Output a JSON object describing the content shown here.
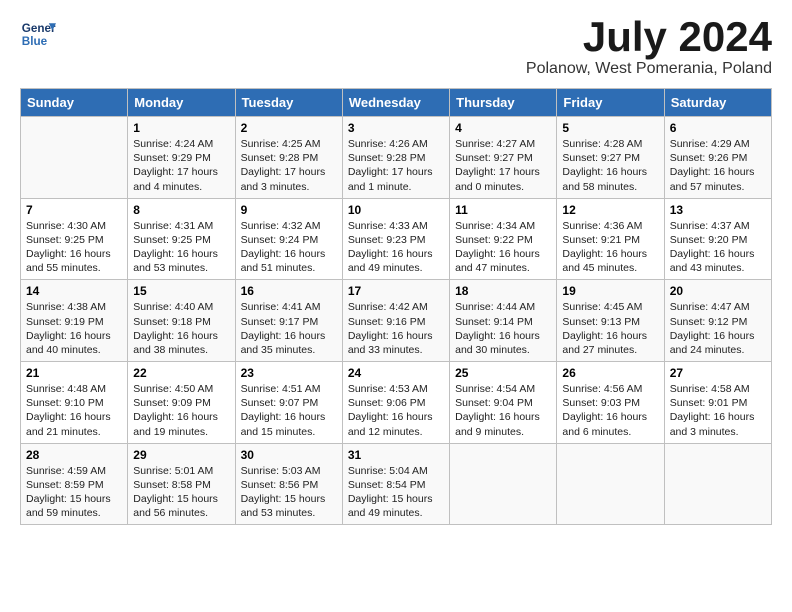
{
  "header": {
    "logo_line1": "General",
    "logo_line2": "Blue",
    "month_title": "July 2024",
    "location": "Polanow, West Pomerania, Poland"
  },
  "days_of_week": [
    "Sunday",
    "Monday",
    "Tuesday",
    "Wednesday",
    "Thursday",
    "Friday",
    "Saturday"
  ],
  "weeks": [
    [
      {
        "day": "",
        "content": ""
      },
      {
        "day": "1",
        "content": "Sunrise: 4:24 AM\nSunset: 9:29 PM\nDaylight: 17 hours\nand 4 minutes."
      },
      {
        "day": "2",
        "content": "Sunrise: 4:25 AM\nSunset: 9:28 PM\nDaylight: 17 hours\nand 3 minutes."
      },
      {
        "day": "3",
        "content": "Sunrise: 4:26 AM\nSunset: 9:28 PM\nDaylight: 17 hours\nand 1 minute."
      },
      {
        "day": "4",
        "content": "Sunrise: 4:27 AM\nSunset: 9:27 PM\nDaylight: 17 hours\nand 0 minutes."
      },
      {
        "day": "5",
        "content": "Sunrise: 4:28 AM\nSunset: 9:27 PM\nDaylight: 16 hours\nand 58 minutes."
      },
      {
        "day": "6",
        "content": "Sunrise: 4:29 AM\nSunset: 9:26 PM\nDaylight: 16 hours\nand 57 minutes."
      }
    ],
    [
      {
        "day": "7",
        "content": "Sunrise: 4:30 AM\nSunset: 9:25 PM\nDaylight: 16 hours\nand 55 minutes."
      },
      {
        "day": "8",
        "content": "Sunrise: 4:31 AM\nSunset: 9:25 PM\nDaylight: 16 hours\nand 53 minutes."
      },
      {
        "day": "9",
        "content": "Sunrise: 4:32 AM\nSunset: 9:24 PM\nDaylight: 16 hours\nand 51 minutes."
      },
      {
        "day": "10",
        "content": "Sunrise: 4:33 AM\nSunset: 9:23 PM\nDaylight: 16 hours\nand 49 minutes."
      },
      {
        "day": "11",
        "content": "Sunrise: 4:34 AM\nSunset: 9:22 PM\nDaylight: 16 hours\nand 47 minutes."
      },
      {
        "day": "12",
        "content": "Sunrise: 4:36 AM\nSunset: 9:21 PM\nDaylight: 16 hours\nand 45 minutes."
      },
      {
        "day": "13",
        "content": "Sunrise: 4:37 AM\nSunset: 9:20 PM\nDaylight: 16 hours\nand 43 minutes."
      }
    ],
    [
      {
        "day": "14",
        "content": "Sunrise: 4:38 AM\nSunset: 9:19 PM\nDaylight: 16 hours\nand 40 minutes."
      },
      {
        "day": "15",
        "content": "Sunrise: 4:40 AM\nSunset: 9:18 PM\nDaylight: 16 hours\nand 38 minutes."
      },
      {
        "day": "16",
        "content": "Sunrise: 4:41 AM\nSunset: 9:17 PM\nDaylight: 16 hours\nand 35 minutes."
      },
      {
        "day": "17",
        "content": "Sunrise: 4:42 AM\nSunset: 9:16 PM\nDaylight: 16 hours\nand 33 minutes."
      },
      {
        "day": "18",
        "content": "Sunrise: 4:44 AM\nSunset: 9:14 PM\nDaylight: 16 hours\nand 30 minutes."
      },
      {
        "day": "19",
        "content": "Sunrise: 4:45 AM\nSunset: 9:13 PM\nDaylight: 16 hours\nand 27 minutes."
      },
      {
        "day": "20",
        "content": "Sunrise: 4:47 AM\nSunset: 9:12 PM\nDaylight: 16 hours\nand 24 minutes."
      }
    ],
    [
      {
        "day": "21",
        "content": "Sunrise: 4:48 AM\nSunset: 9:10 PM\nDaylight: 16 hours\nand 21 minutes."
      },
      {
        "day": "22",
        "content": "Sunrise: 4:50 AM\nSunset: 9:09 PM\nDaylight: 16 hours\nand 19 minutes."
      },
      {
        "day": "23",
        "content": "Sunrise: 4:51 AM\nSunset: 9:07 PM\nDaylight: 16 hours\nand 15 minutes."
      },
      {
        "day": "24",
        "content": "Sunrise: 4:53 AM\nSunset: 9:06 PM\nDaylight: 16 hours\nand 12 minutes."
      },
      {
        "day": "25",
        "content": "Sunrise: 4:54 AM\nSunset: 9:04 PM\nDaylight: 16 hours\nand 9 minutes."
      },
      {
        "day": "26",
        "content": "Sunrise: 4:56 AM\nSunset: 9:03 PM\nDaylight: 16 hours\nand 6 minutes."
      },
      {
        "day": "27",
        "content": "Sunrise: 4:58 AM\nSunset: 9:01 PM\nDaylight: 16 hours\nand 3 minutes."
      }
    ],
    [
      {
        "day": "28",
        "content": "Sunrise: 4:59 AM\nSunset: 8:59 PM\nDaylight: 15 hours\nand 59 minutes."
      },
      {
        "day": "29",
        "content": "Sunrise: 5:01 AM\nSunset: 8:58 PM\nDaylight: 15 hours\nand 56 minutes."
      },
      {
        "day": "30",
        "content": "Sunrise: 5:03 AM\nSunset: 8:56 PM\nDaylight: 15 hours\nand 53 minutes."
      },
      {
        "day": "31",
        "content": "Sunrise: 5:04 AM\nSunset: 8:54 PM\nDaylight: 15 hours\nand 49 minutes."
      },
      {
        "day": "",
        "content": ""
      },
      {
        "day": "",
        "content": ""
      },
      {
        "day": "",
        "content": ""
      }
    ]
  ]
}
